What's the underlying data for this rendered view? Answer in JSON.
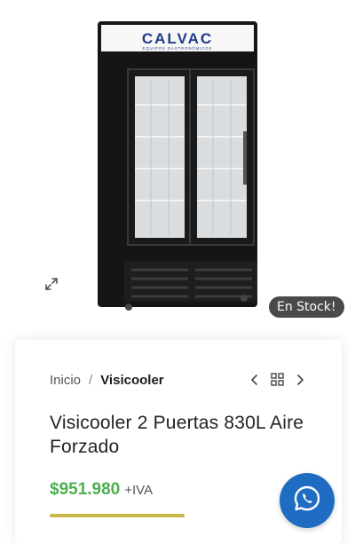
{
  "product_image": {
    "brand_name": "CALVAC",
    "brand_tagline": "EQUIPOS GASTRONÓMICOS",
    "zoom_icon": "expand-icon"
  },
  "stock_badge": "En Stock!",
  "breadcrumb": {
    "home": "Inicio",
    "separator": "/",
    "current": "Visicooler"
  },
  "product_nav": {
    "prev_icon": "chevron-left-icon",
    "grid_icon": "grid-icon",
    "next_icon": "chevron-right-icon"
  },
  "product": {
    "title": "Visicooler 2 Puertas 830L Aire Forzado",
    "price": "$951.980",
    "tax_suffix": "+IVA"
  },
  "floating": {
    "whatsapp_icon": "whatsapp-icon"
  },
  "colors": {
    "price": "#4caf50",
    "badge_bg": "#4a4a4a",
    "whatsapp_bg": "#1f6dc2",
    "brand_blue": "#1e3a8a"
  }
}
